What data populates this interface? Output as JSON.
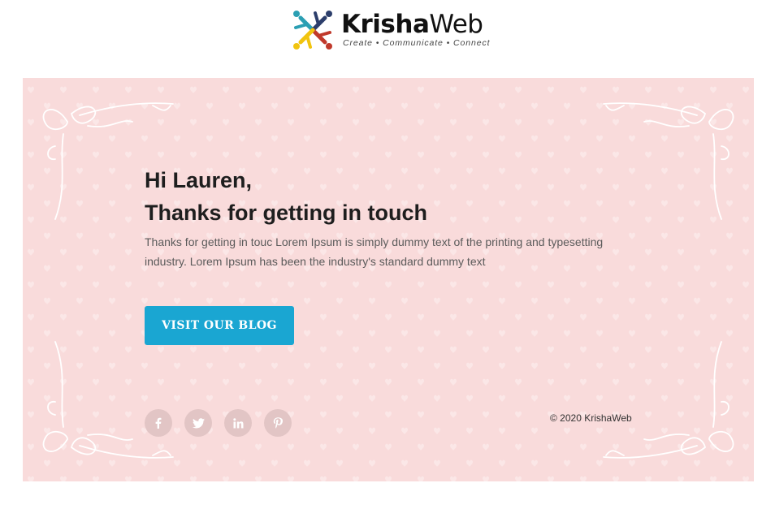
{
  "header": {
    "logo_name_bold": "Krisha",
    "logo_name_light": "Web",
    "logo_tagline": "Create • Communicate • Connect"
  },
  "email": {
    "greeting_line1": "Hi Lauren,",
    "greeting_line2": "Thanks for getting in touch",
    "body": "Thanks for getting in touc Lorem Ipsum is simply dummy text of the printing and typesetting industry. Lorem Ipsum has been the industry's standard dummy text",
    "cta_label": "VISIT OUR BLOG"
  },
  "footer": {
    "social_icons": [
      "facebook-icon",
      "twitter-icon",
      "linkedin-icon",
      "pinterest-icon"
    ],
    "copyright": "© 2020 KrishaWeb"
  },
  "colors": {
    "card_background": "#f9dbdb",
    "cta_background": "#1aa6d2",
    "social_circle": "#e2c5c5",
    "logo_teal": "#2b9fb3",
    "logo_red": "#c0392b",
    "logo_yellow": "#f1c40f",
    "logo_navy": "#2c3e6b"
  }
}
